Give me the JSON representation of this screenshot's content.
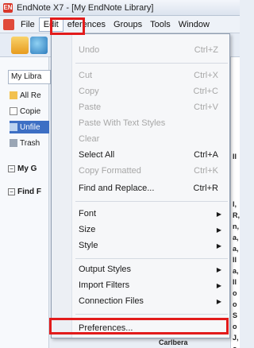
{
  "window": {
    "title": "EndNote X7 - [My EndNote Library]",
    "logo_text": "EN"
  },
  "menubar": {
    "items": [
      "File",
      "Edit",
      "References",
      "Groups",
      "Tools",
      "Window"
    ],
    "display": [
      "File",
      "Edit",
      "eferences",
      "Groups",
      "Tools",
      "Window"
    ]
  },
  "left_panel": {
    "library_dropdown": "My Libra",
    "groups": [
      "All Re",
      "Copie",
      "Unfile",
      "Trash"
    ],
    "headers": [
      "My G",
      "Find F"
    ]
  },
  "edit_menu": {
    "items": [
      {
        "label": "Undo",
        "shortcut": "Ctrl+Z",
        "enabled": false
      },
      {
        "label": "Cut",
        "shortcut": "Ctrl+X",
        "enabled": false
      },
      {
        "label": "Copy",
        "shortcut": "Ctrl+C",
        "enabled": false
      },
      {
        "label": "Paste",
        "shortcut": "Ctrl+V",
        "enabled": false
      },
      {
        "label": "Paste With Text Styles",
        "shortcut": "",
        "enabled": false
      },
      {
        "label": "Clear",
        "shortcut": "",
        "enabled": false
      },
      {
        "label": "Select All",
        "shortcut": "Ctrl+A",
        "enabled": true
      },
      {
        "label": "Copy Formatted",
        "shortcut": "Ctrl+K",
        "enabled": false
      },
      {
        "label": "Find and Replace...",
        "shortcut": "Ctrl+R",
        "enabled": true
      },
      {
        "label": "Font",
        "enabled": true,
        "submenu": true
      },
      {
        "label": "Size",
        "enabled": true,
        "submenu": true
      },
      {
        "label": "Style",
        "enabled": true,
        "submenu": true
      },
      {
        "label": "Output Styles",
        "enabled": true,
        "submenu": true
      },
      {
        "label": "Import Filters",
        "enabled": true,
        "submenu": true
      },
      {
        "label": "Connection Files",
        "enabled": true,
        "submenu": true
      },
      {
        "label": "Preferences...",
        "enabled": true
      }
    ]
  },
  "content_fragments": [
    "ll",
    "l,",
    "R,",
    "n,",
    "a,",
    "a,",
    "ll",
    "a,",
    "ll",
    "o",
    "o",
    "S",
    "o",
    "J,",
    "o"
  ],
  "bottom_fragment": "Carlbera",
  "highlight_color": "#e21b1b"
}
